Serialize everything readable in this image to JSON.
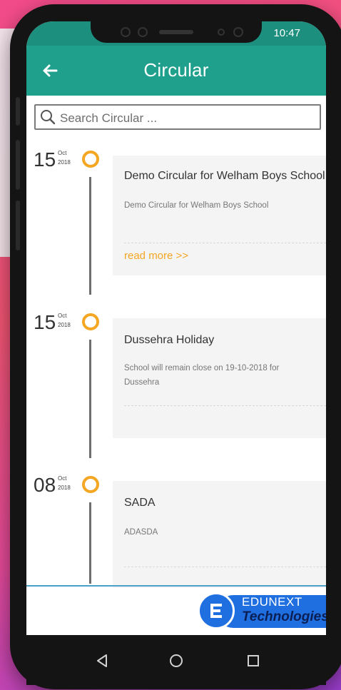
{
  "status": {
    "time": "10:47"
  },
  "header": {
    "title": "Circular"
  },
  "search": {
    "placeholder": "Search Circular ..."
  },
  "circulars": [
    {
      "day": "15",
      "month": "Oct",
      "year": "2018",
      "title": "Demo Circular for Welham Boys School",
      "description": "Demo Circular for Welham Boys School",
      "read_more": "read more >>"
    },
    {
      "day": "15",
      "month": "Oct",
      "year": "2018",
      "title": "Dussehra Holiday",
      "description": "School will remain close on 19-10-2018 for Dussehra"
    },
    {
      "day": "08",
      "month": "Oct",
      "year": "2018",
      "title": "SADA",
      "description": "ADASDA"
    }
  ],
  "brand": {
    "line1": "EDUNEXT",
    "line2": "Technologies"
  },
  "colors": {
    "appbar": "#1fa08c",
    "statusbar": "#1d8f7e",
    "accent": "#f5a623",
    "brand": "#1f6fe0"
  },
  "icons": {
    "back": "arrow-left-icon",
    "search": "magnifier-icon",
    "nav": [
      "back-triangle-icon",
      "home-circle-icon",
      "recents-square-icon"
    ]
  }
}
